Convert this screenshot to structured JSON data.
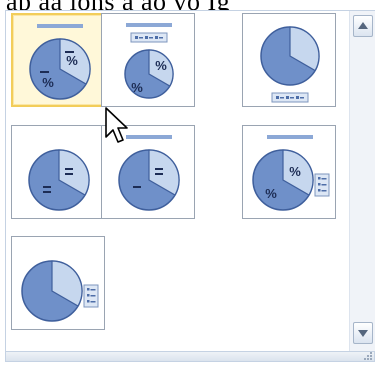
{
  "caption": "ap aa ions a ao vo Ig",
  "colors": {
    "pie_fill": "#6f90c9",
    "pie_slice": "#c6d7ee",
    "pie_stroke": "#3f5f9c",
    "title_bar": "#8ca8d6",
    "selected_border": "#f2cd5a"
  },
  "gallery": {
    "selected_index": 0,
    "layouts": [
      {
        "title": "top",
        "labels": "percent",
        "legend": "none"
      },
      {
        "title": "top",
        "labels": "percent",
        "legend": "top"
      },
      {
        "title": "none",
        "labels": "none",
        "legend": "bottom"
      },
      {
        "title": "none",
        "labels": "dash",
        "legend": "none"
      },
      {
        "title": "top",
        "labels": "dash",
        "legend": "none"
      },
      {
        "title": "top",
        "labels": "percent",
        "legend": "right"
      },
      {
        "title": "none",
        "labels": "none",
        "legend": "right"
      }
    ]
  },
  "scrollbar": {
    "up_icon": "triangle-up",
    "down_icon": "triangle-down"
  },
  "cursor_icon": "arrow-pointer"
}
